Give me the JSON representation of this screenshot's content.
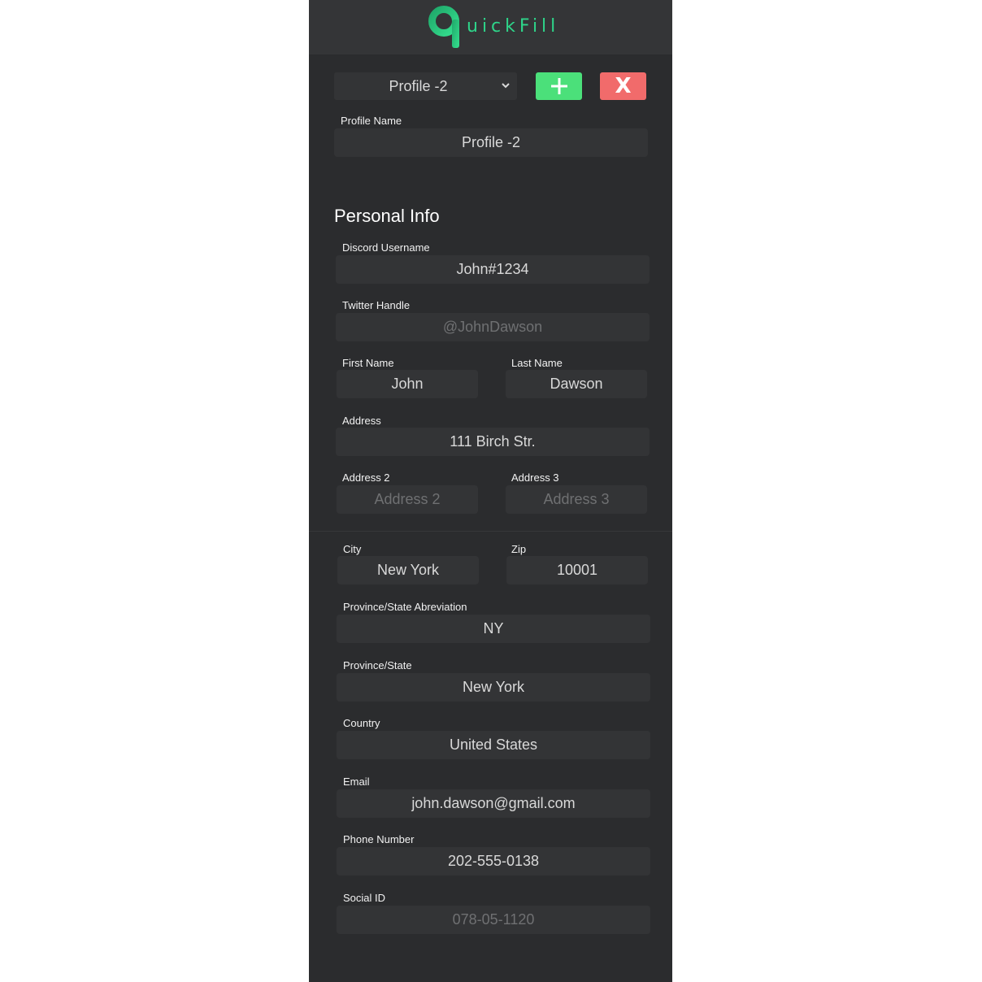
{
  "app": {
    "logo_text": "uickFill",
    "accent_color": "#2ed58a"
  },
  "toolbar": {
    "profile_select": "Profile -2",
    "add_label": "+",
    "delete_label": "X"
  },
  "profile": {
    "name_label": "Profile Name",
    "name_value": "Profile -2"
  },
  "personal": {
    "title": "Personal Info",
    "discord": {
      "label": "Discord Username",
      "value": "John#1234"
    },
    "twitter": {
      "label": "Twitter Handle",
      "value": "",
      "placeholder": "@JohnDawson"
    },
    "first_name": {
      "label": "First Name",
      "value": "John"
    },
    "last_name": {
      "label": "Last Name",
      "value": "Dawson"
    },
    "address": {
      "label": "Address",
      "value": "111 Birch Str."
    },
    "address2": {
      "label": "Address 2",
      "value": "",
      "placeholder": "Address 2"
    },
    "address3": {
      "label": "Address 3",
      "value": "",
      "placeholder": "Address 3"
    },
    "city": {
      "label": "City",
      "value": "New York"
    },
    "zip": {
      "label": "Zip",
      "value": "10001"
    },
    "state_abbr": {
      "label": "Province/State Abreviation",
      "value": "NY"
    },
    "state": {
      "label": "Province/State",
      "value": "New York"
    },
    "country": {
      "label": "Country",
      "value": "United States"
    },
    "email": {
      "label": "Email",
      "value": "john.dawson@gmail.com"
    },
    "phone": {
      "label": "Phone Number",
      "value": "202-555-0138"
    },
    "social_id": {
      "label": "Social ID",
      "value": "",
      "placeholder": "078-05-1120"
    }
  }
}
